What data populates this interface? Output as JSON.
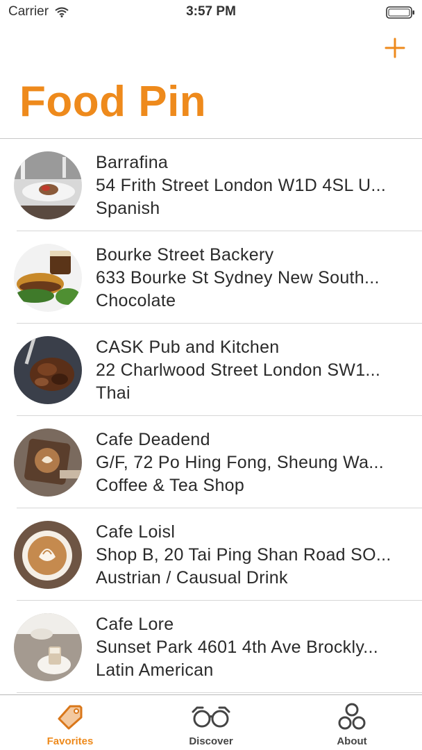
{
  "status_bar": {
    "carrier": "Carrier",
    "time": "3:57 PM"
  },
  "nav": {
    "title": "Food Pin",
    "add_icon": "plus-icon"
  },
  "accent_color": "#ee8a1c",
  "restaurants": [
    {
      "name": "Barrafina",
      "location": "54 Frith Street London W1D 4SL U...",
      "type": "Spanish"
    },
    {
      "name": "Bourke Street Backery",
      "location": "633 Bourke St Sydney New South...",
      "type": "Chocolate"
    },
    {
      "name": "CASK Pub and Kitchen",
      "location": "22 Charlwood Street London SW1...",
      "type": "Thai"
    },
    {
      "name": "Cafe Deadend",
      "location": "G/F, 72 Po Hing Fong, Sheung Wa...",
      "type": "Coffee & Tea Shop"
    },
    {
      "name": "Cafe Loisl",
      "location": "Shop B, 20 Tai Ping Shan Road SO...",
      "type": "Austrian / Causual Drink"
    },
    {
      "name": "Cafe Lore",
      "location": "Sunset Park 4601 4th Ave Brockly...",
      "type": "Latin American"
    }
  ],
  "tabs": [
    {
      "label": "Favorites",
      "icon": "tag-icon",
      "active": true
    },
    {
      "label": "Discover",
      "icon": "glasses-icon",
      "active": false
    },
    {
      "label": "About",
      "icon": "circles-icon",
      "active": false
    }
  ]
}
